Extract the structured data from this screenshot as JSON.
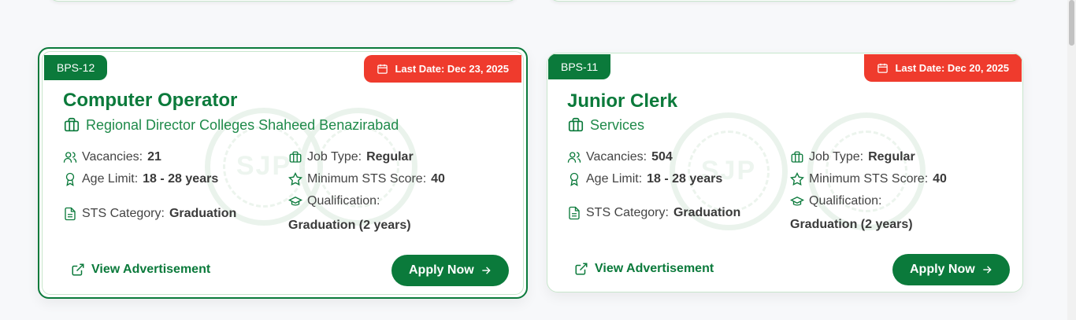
{
  "cards": [
    {
      "bps": "BPS-12",
      "last_date": "Last Date: Dec 23, 2025",
      "title": "Computer Operator",
      "department": "Regional Director Colleges Shaheed Benazirabad",
      "vacancies_label": "Vacancies:",
      "vacancies": "21",
      "age_label": "Age Limit:",
      "age": "18 - 28 years",
      "category_label": "STS Category:",
      "category": "Graduation",
      "job_type_label": "Job Type:",
      "job_type": "Regular",
      "sts_score_label": "Minimum STS Score:",
      "sts_score": "40",
      "qualification_label": "Qualification:",
      "qualification": "Graduation (2 years)",
      "view_ad": "View Advertisement",
      "apply": "Apply Now"
    },
    {
      "bps": "BPS-11",
      "last_date": "Last Date: Dec 20, 2025",
      "title": "Junior Clerk",
      "department": "Services",
      "vacancies_label": "Vacancies:",
      "vacancies": "504",
      "age_label": "Age Limit:",
      "age": "18 - 28 years",
      "category_label": "STS Category:",
      "category": "Graduation",
      "job_type_label": "Job Type:",
      "job_type": "Regular",
      "sts_score_label": "Minimum STS Score:",
      "sts_score": "40",
      "qualification_label": "Qualification:",
      "qualification": "Graduation (2 years)",
      "view_ad": "View Advertisement",
      "apply": "Apply Now"
    }
  ],
  "watermark_text": "SJP",
  "colors": {
    "primary": "#0b7a3b",
    "deadline": "#ef3b2d",
    "border": "#c8e6cc"
  }
}
